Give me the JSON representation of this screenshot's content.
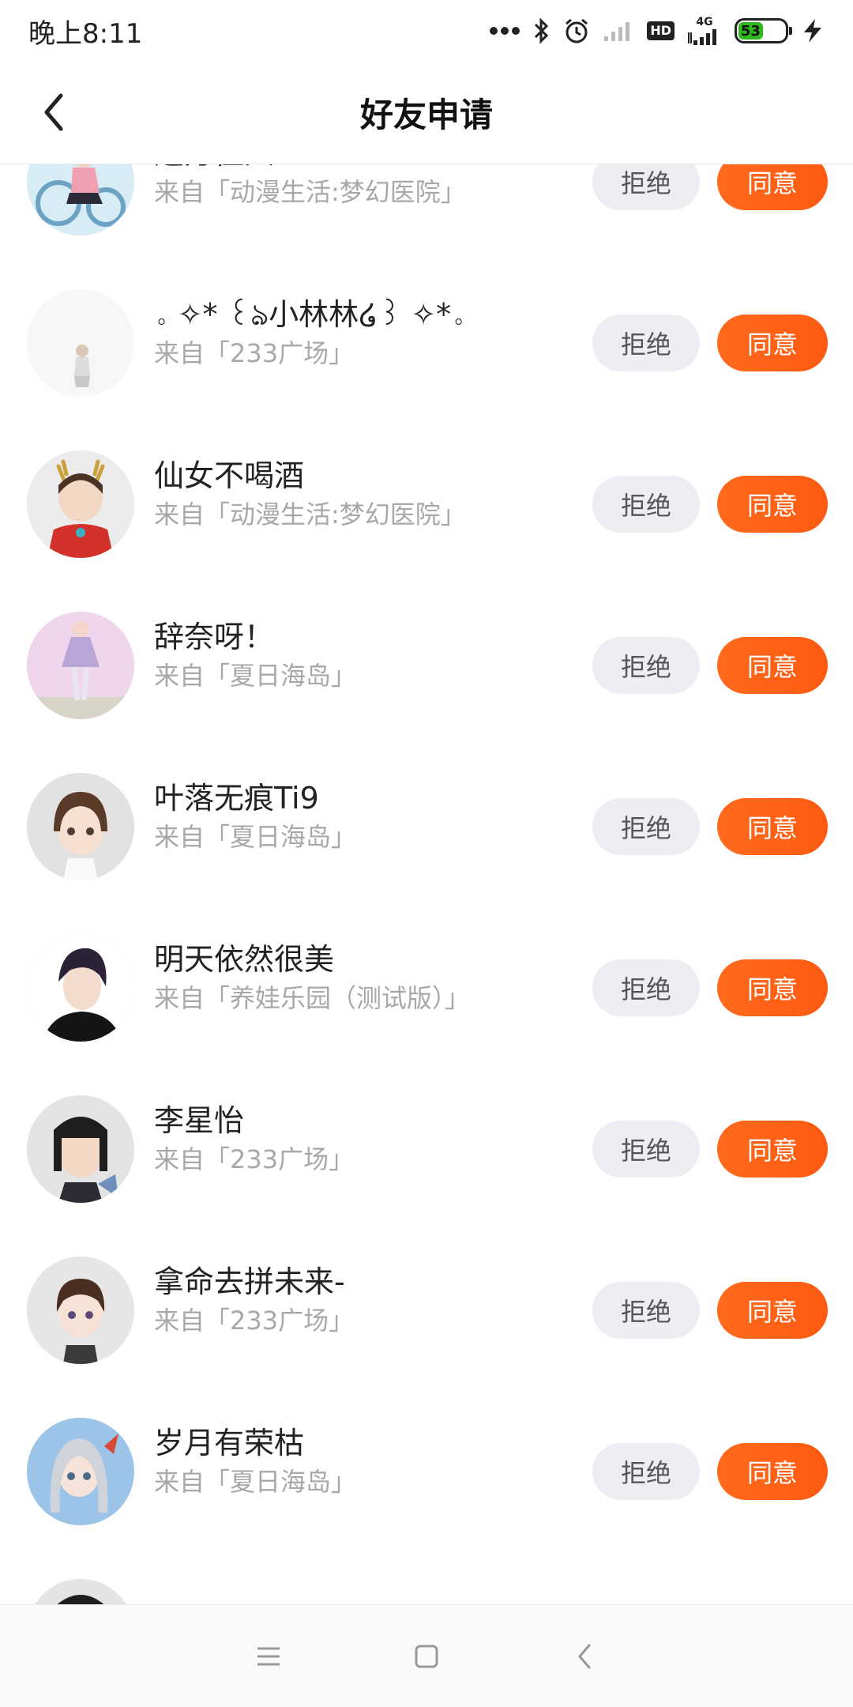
{
  "status_bar": {
    "time": "晚上8:11",
    "hd_label": "HD",
    "network_label": "4G",
    "battery_level": "53"
  },
  "header": {
    "title": "好友申请"
  },
  "actions": {
    "reject_label": "拒绝",
    "accept_label": "同意"
  },
  "requests": [
    {
      "name": "远方佳人",
      "source": "来自「动漫生活:梦幻医院」",
      "avatar": "avatar-bike-girl"
    },
    {
      "name": "。✧* ꒰ঌ小林林໒꒱ ✧*。",
      "source": "来自「233广场」",
      "avatar": "avatar-small-figure"
    },
    {
      "name": "仙女不喝酒",
      "source": "来自「动漫生活:梦幻医院」",
      "avatar": "avatar-antler-boy"
    },
    {
      "name": "辞奈呀！",
      "source": "来自「夏日海岛」",
      "avatar": "avatar-dress-doll"
    },
    {
      "name": "叶落无痕Ti9",
      "source": "来自「夏日海岛」",
      "avatar": "avatar-brown-hair-girl"
    },
    {
      "name": "明天依然很美",
      "source": "来自「养娃乐园（测试版）」",
      "avatar": "avatar-dark-hair-boy"
    },
    {
      "name": "李星怡",
      "source": "来自「233广场」",
      "avatar": "avatar-bob-girl"
    },
    {
      "name": "拿命去拼未来-",
      "source": "来自「233广场」",
      "avatar": "avatar-short-hair-girl"
    },
    {
      "name": "岁月有荣枯",
      "source": "来自「夏日海岛」",
      "avatar": "avatar-silver-hair-girl"
    }
  ],
  "colors": {
    "accept": "#ff5f16",
    "reject_bg": "#edeef3",
    "source_text": "#a8a8a8"
  }
}
